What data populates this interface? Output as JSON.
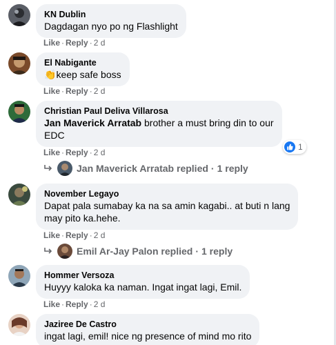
{
  "comments": [
    {
      "author": "KN Dublin",
      "text": "Dagdagan nyo po ng Flashlight",
      "actions": {
        "like": "Like",
        "reply": "Reply",
        "time": "2 d"
      }
    },
    {
      "author": "El Nabigante",
      "emoji": "👏",
      "text": "keep safe boss",
      "actions": {
        "like": "Like",
        "reply": "Reply",
        "time": "2 d"
      }
    },
    {
      "author": "Christian Paul Deliva Villarosa",
      "mention": "Jan Maverick Arratab",
      "text": " brother a must bring din to our\nEDC",
      "actions": {
        "like": "Like",
        "reply": "Reply",
        "time": "2 d"
      },
      "reaction": {
        "icon": "like-icon",
        "count": "1"
      },
      "replies": {
        "name": "Jan Maverick Arratab",
        "verb": "replied",
        "count": "1 reply"
      }
    },
    {
      "author": "November Legayo",
      "text": "Dapat pala sumabay ka na sa amin kagabi.. at buti n lang\nmay pito ka.hehe.",
      "actions": {
        "like": "Like",
        "reply": "Reply",
        "time": "2 d"
      },
      "replies": {
        "name": "Emil Ar-Jay Palon",
        "verb": "replied",
        "count": "1 reply"
      }
    },
    {
      "author": "Hommer Versoza",
      "text": "Huyyy kaloka ka naman. Ingat ingat lagi, Emil.",
      "actions": {
        "like": "Like",
        "reply": "Reply",
        "time": "2 d"
      }
    },
    {
      "author": "Jaziree De Castro",
      "text": "ingat lagi, emil! nice ng presence of mind mo rito"
    }
  ],
  "colors": {
    "bubble": "#f0f2f5",
    "meta_text": "#65676b",
    "like_blue": "#1877f2"
  }
}
